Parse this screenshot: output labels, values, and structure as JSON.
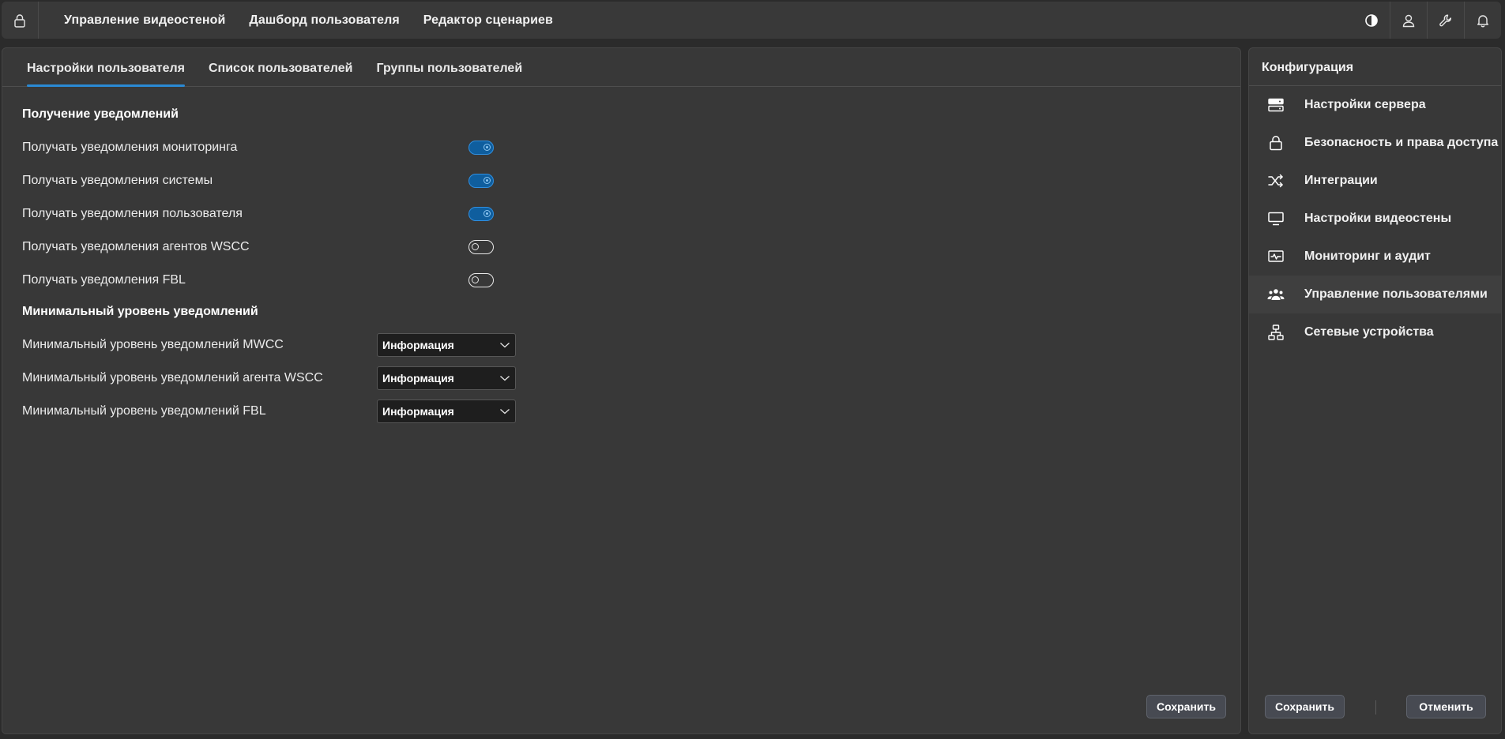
{
  "topbar": {
    "lock_icon": "lock-icon",
    "nav": [
      {
        "label": "Управление видеостеной"
      },
      {
        "label": "Дашборд пользователя"
      },
      {
        "label": "Редактор сценариев"
      }
    ],
    "icons": [
      "theme-contrast-icon",
      "user-icon",
      "wrench-icon",
      "bell-icon"
    ]
  },
  "tabs": [
    {
      "label": "Настройки пользователя",
      "active": true
    },
    {
      "label": "Список пользователей",
      "active": false
    },
    {
      "label": "Группы пользователей",
      "active": false
    }
  ],
  "notifications": {
    "title": "Получение уведомлений",
    "items": [
      {
        "label": "Получать уведомления мониторинга",
        "on": true
      },
      {
        "label": "Получать уведомления системы",
        "on": true
      },
      {
        "label": "Получать уведомления пользователя",
        "on": true
      },
      {
        "label": "Получать уведомления агентов WSCC",
        "on": false
      },
      {
        "label": "Получать уведомления FBL",
        "on": false
      }
    ]
  },
  "levels": {
    "title": "Минимальный уровень уведомлений",
    "items": [
      {
        "label": "Минимальный уровень уведомлений MWCC",
        "value": "Информация"
      },
      {
        "label": "Минимальный уровень уведомлений агента WSCC",
        "value": "Информация"
      },
      {
        "label": "Минимальный уровень уведомлений FBL",
        "value": "Информация"
      }
    ]
  },
  "main": {
    "save_label": "Сохранить"
  },
  "sidebar": {
    "title": "Конфигурация",
    "items": [
      {
        "label": "Настройки сервера",
        "icon": "server-icon",
        "active": false
      },
      {
        "label": "Безопасность и права доступа",
        "icon": "lock-icon",
        "active": false
      },
      {
        "label": "Интеграции",
        "icon": "shuffle-icon",
        "active": false
      },
      {
        "label": "Настройки видеостены",
        "icon": "monitor-icon",
        "active": false
      },
      {
        "label": "Мониторинг и аудит",
        "icon": "activity-icon",
        "active": false
      },
      {
        "label": "Управление пользователями",
        "icon": "users-icon",
        "active": true
      },
      {
        "label": "Сетевые устройства",
        "icon": "network-icon",
        "active": false
      }
    ],
    "save_label": "Сохранить",
    "cancel_label": "Отменить"
  },
  "colors": {
    "accent": "#2a8ad4",
    "toggle_on_bg": "#0f5e9e",
    "panel_bg": "#383838",
    "page_bg": "#2b2b2b"
  }
}
